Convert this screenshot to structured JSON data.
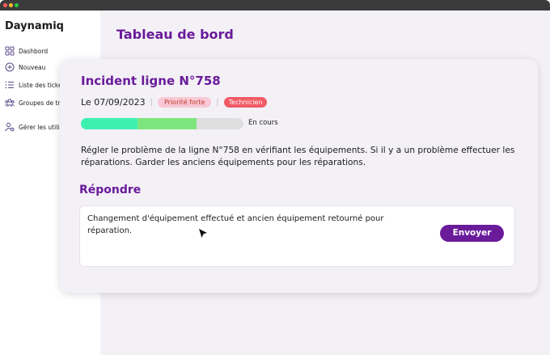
{
  "window": {
    "controls": [
      {
        "name": "close",
        "color": "#ff5f57"
      },
      {
        "name": "minimize",
        "color": "#febc2e"
      },
      {
        "name": "maximize",
        "color": "#28c840"
      }
    ]
  },
  "sidebar": {
    "brand": "Daynamiq",
    "items": [
      {
        "label": "Dashbord",
        "icon": "grid-icon"
      },
      {
        "label": "Nouveau",
        "icon": "plus-circle-icon"
      },
      {
        "label": "Liste des tickets",
        "icon": "list-icon"
      },
      {
        "label": "Groupes de travail",
        "icon": "users-group-icon"
      },
      {
        "label": "Gérer les utilisateurs",
        "icon": "user-settings-icon"
      }
    ]
  },
  "main": {
    "title": "Tableau de bord"
  },
  "incident": {
    "title": "Incident ligne N°758",
    "date": "Le 07/09/2023",
    "priority_badge": "Priorité forte",
    "role_badge": "Technicien",
    "progress": {
      "label": "En cours",
      "segments": [
        {
          "fraction": 0.35,
          "color": "#3df0b0"
        },
        {
          "fraction": 0.36,
          "color": "#7de57d"
        }
      ],
      "track_color": "#dedede"
    },
    "description": "Régler le problème de la ligne N°758 en vérifiant les équipements. Si il y a un problème effectuer les réparations. Garder les anciens équipements pour les réparations."
  },
  "reply": {
    "title": "Répondre",
    "text": "Changement d'équipement effectué et ancien équipement retourné pour réparation.",
    "send_label": "Envoyer"
  },
  "colors": {
    "accent": "#6a1b9a",
    "priority_bg": "#f8c8d4",
    "priority_text": "#c0392b",
    "role_bg": "#f25a66"
  }
}
